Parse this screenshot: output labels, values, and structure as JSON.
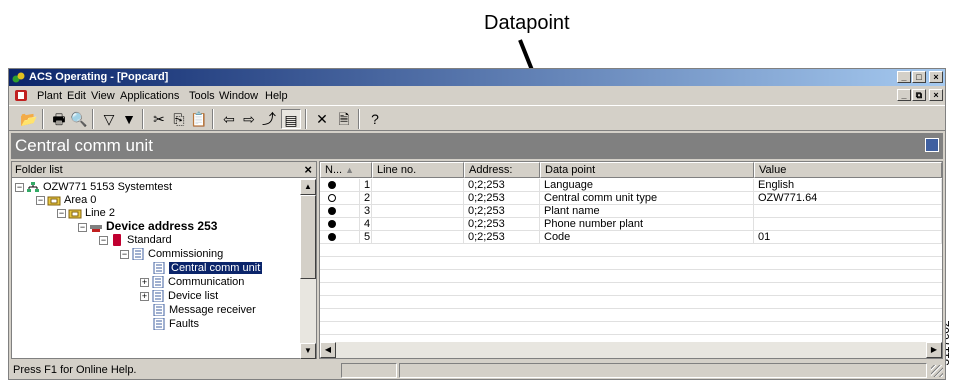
{
  "callout": {
    "label": "Datapoint"
  },
  "side_code": "3117c02",
  "window": {
    "title": "ACS Operating - [Popcard]",
    "buttons": {
      "minimize": "_",
      "maximize": "□",
      "close": "×"
    }
  },
  "menubar": {
    "items": [
      {
        "label": "Plant"
      },
      {
        "label": "Edit"
      },
      {
        "label": "View"
      },
      {
        "label": "Applications"
      },
      {
        "label": "Tools"
      },
      {
        "label": "Window"
      },
      {
        "label": "Help"
      }
    ],
    "mdi_buttons": {
      "minimize": "_",
      "restore": "⧉",
      "close": "×"
    }
  },
  "toolbar": {
    "buttons": [
      {
        "icon": "open-folder-icon",
        "glyph": "📂"
      },
      {
        "icon": "print-icon",
        "glyph": "🖶"
      },
      {
        "icon": "print-preview-icon",
        "glyph": "🔍"
      },
      {
        "icon": "filter-icon",
        "glyph": "▽"
      },
      {
        "icon": "filter-set-icon",
        "glyph": "▼"
      },
      {
        "icon": "cut-icon",
        "glyph": "✂"
      },
      {
        "icon": "copy-icon",
        "glyph": "⎘"
      },
      {
        "icon": "paste-icon",
        "glyph": "📋"
      },
      {
        "icon": "back-arrow-icon",
        "glyph": "⇦"
      },
      {
        "icon": "forward-arrow-icon",
        "glyph": "⇨"
      },
      {
        "icon": "up-folder-icon",
        "glyph": "⤴"
      },
      {
        "icon": "details-view-icon",
        "glyph": "▤"
      },
      {
        "icon": "delete-icon",
        "glyph": "✕"
      },
      {
        "icon": "properties-icon",
        "glyph": "🗎"
      },
      {
        "icon": "help-icon",
        "glyph": "?"
      }
    ]
  },
  "heading": "Central comm unit",
  "folder_list": {
    "header": "Folder list",
    "close": "×",
    "tree": [
      {
        "label": "OZW771 5153 Systemtest",
        "expander": "⊟",
        "icon": "network"
      },
      {
        "label": "Area 0",
        "expander": "⊟",
        "icon": "folder"
      },
      {
        "label": "Line 2",
        "expander": "⊟",
        "icon": "folder"
      },
      {
        "label": "Device address 253",
        "expander": "⊟",
        "icon": "device"
      },
      {
        "label": "Standard",
        "expander": "⊟",
        "icon": "red-book"
      },
      {
        "label": "Commissioning",
        "expander": "⊟",
        "icon": "page"
      },
      {
        "label": "Central comm unit",
        "expander": "",
        "icon": "page"
      },
      {
        "label": "Communication",
        "expander": "⊞",
        "icon": "page"
      },
      {
        "label": "Device list",
        "expander": "⊞",
        "icon": "page"
      },
      {
        "label": "Message receiver",
        "expander": "",
        "icon": "page"
      },
      {
        "label": "Faults",
        "expander": "",
        "icon": "page"
      }
    ]
  },
  "datapoint_table": {
    "columns": [
      {
        "label": "N...",
        "sort": "▲"
      },
      {
        "label": "Line no."
      },
      {
        "label": "Address:"
      },
      {
        "label": "Data point"
      },
      {
        "label": "Value"
      }
    ],
    "rows": [
      {
        "marker": "filled",
        "no": "1",
        "line": "",
        "address": "0;2;253",
        "datapoint": "Language",
        "value": "English"
      },
      {
        "marker": "open",
        "no": "2",
        "line": "",
        "address": "0;2;253",
        "datapoint": "Central comm unit type",
        "value": "OZW771.64"
      },
      {
        "marker": "filled",
        "no": "3",
        "line": "",
        "address": "0;2;253",
        "datapoint": "Plant name",
        "value": ""
      },
      {
        "marker": "filled",
        "no": "4",
        "line": "",
        "address": "0;2;253",
        "datapoint": "Phone number plant",
        "value": ""
      },
      {
        "marker": "filled",
        "no": "5",
        "line": "",
        "address": "0;2;253",
        "datapoint": "Code",
        "value": "01"
      }
    ]
  },
  "statusbar": {
    "message": "Press F1 for Online Help."
  }
}
